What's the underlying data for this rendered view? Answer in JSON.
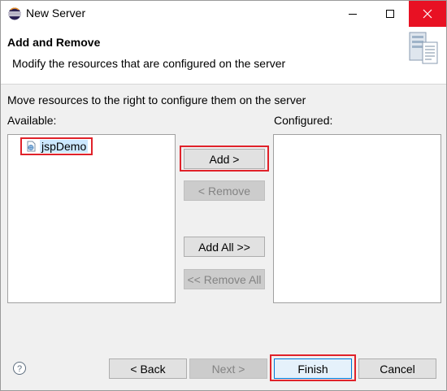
{
  "window": {
    "title": "New Server"
  },
  "banner": {
    "title": "Add and Remove",
    "description": "Modify the resources that are configured on the server"
  },
  "instruction": "Move resources to the right to configure them on the server",
  "available": {
    "label": "Available:",
    "items": [
      {
        "label": "jspDemo",
        "icon": "web-project-icon"
      }
    ]
  },
  "configured": {
    "label": "Configured:",
    "items": []
  },
  "transfer_buttons": {
    "add": "Add >",
    "remove": "< Remove",
    "add_all": "Add All >>",
    "remove_all": "<< Remove All"
  },
  "footer": {
    "back": "< Back",
    "next": "Next >",
    "finish": "Finish",
    "cancel": "Cancel"
  },
  "colors": {
    "highlight_frame": "#e0222a",
    "selection": "#cce8ff",
    "close_hover": "#e81123"
  }
}
